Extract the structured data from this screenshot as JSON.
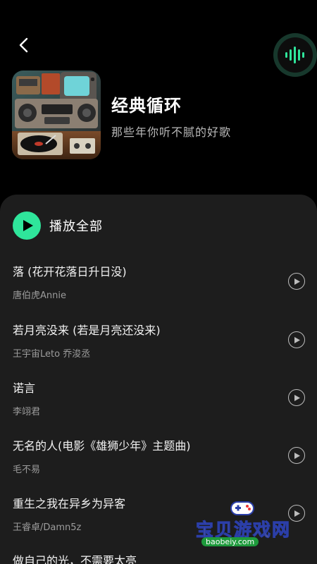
{
  "header": {
    "back_icon": "chevron-left-icon",
    "sound_icon": "sound-wave-icon",
    "accent_color": "#2fe59b"
  },
  "playlist": {
    "title": "经典循环",
    "subtitle": "那些年你听不腻的好歌"
  },
  "play_all": {
    "label": "播放全部"
  },
  "songs": [
    {
      "title": "落 (花开花落日升日没)",
      "artist": "唐伯虎Annie"
    },
    {
      "title": "若月亮没来 (若是月亮还没来)",
      "artist": "王宇宙Leto 乔浚丞"
    },
    {
      "title": "诺言",
      "artist": "李翊君"
    },
    {
      "title": "无名的人(电影《雄狮少年》主题曲)",
      "artist": "毛不易"
    },
    {
      "title": "重生之我在异乡为异客",
      "artist": "王睿卓/Damn5z"
    },
    {
      "title": "做自己的光，不需要太亮",
      "artist": ""
    }
  ],
  "watermark": {
    "text": "宝贝游戏网",
    "url": "baobeiy.com"
  }
}
